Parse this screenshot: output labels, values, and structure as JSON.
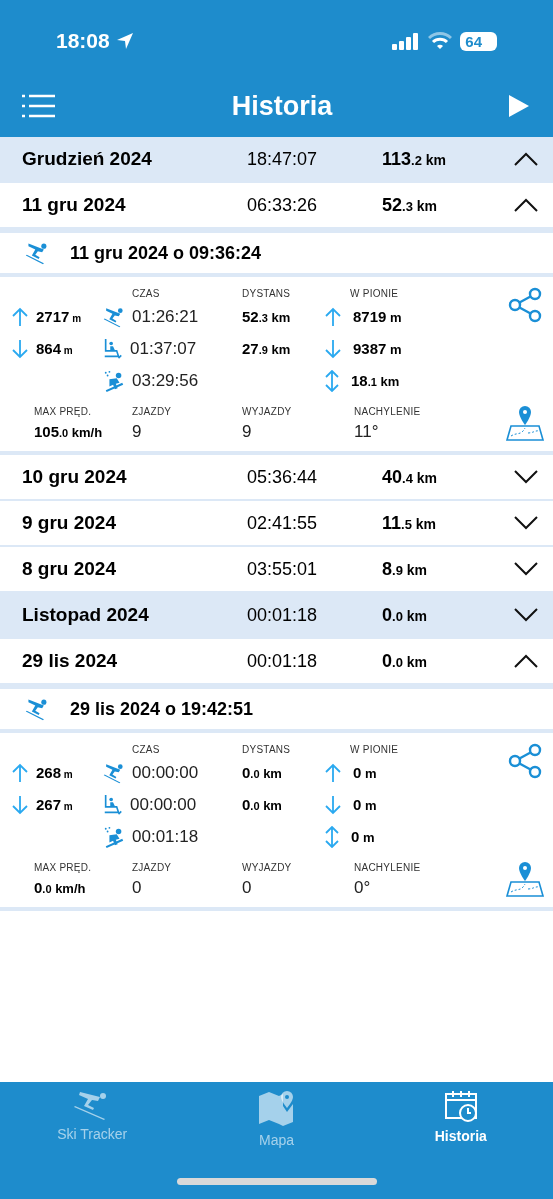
{
  "status_bar": {
    "time": "18:08",
    "battery": "64"
  },
  "header": {
    "title": "Historia"
  },
  "rows": [
    {
      "kind": "month",
      "label": "Grudzień 2024",
      "time": "18:47:07",
      "distance": {
        "int": "113",
        "dec": ".2",
        "unit": "km"
      },
      "expanded": true
    },
    {
      "kind": "day",
      "label": "11 gru 2024",
      "time": "06:33:26",
      "distance": {
        "int": "52",
        "dec": ".3",
        "unit": "km"
      },
      "expanded": true
    },
    {
      "kind": "session",
      "title": "11 gru 2024 o 09:36:24",
      "altitude": [
        {
          "kind": "up",
          "value": {
            "int": "2717",
            "unit": "m"
          }
        },
        {
          "kind": "down",
          "value": {
            "int": "864",
            "unit": "m"
          }
        }
      ],
      "headers": [
        "CZAS",
        "DYSTANS",
        "W PIONIE"
      ],
      "times": [
        {
          "kind": "ski",
          "value": "01:26:21"
        },
        {
          "kind": "lift",
          "value": "01:37:07"
        },
        {
          "kind": "other",
          "value": "03:29:56"
        }
      ],
      "distances": [
        {
          "int": "52",
          "dec": ".3",
          "unit": "km"
        },
        {
          "int": "27",
          "dec": ".9",
          "unit": "km"
        }
      ],
      "vertical": [
        {
          "kind": "up",
          "value": {
            "int": "8719",
            "unit": "m"
          }
        },
        {
          "kind": "down",
          "value": {
            "int": "9387",
            "unit": "m"
          }
        },
        {
          "kind": "both",
          "value": {
            "int": "18",
            "dec": ".1",
            "unit": "km"
          }
        }
      ],
      "summary_labels": [
        "MAX PRĘD.",
        "ZJAZDY",
        "WYJAZDY",
        "NACHYLENIE"
      ],
      "max_speed": {
        "int": "105",
        "dec": ".0",
        "unit": "km/h"
      },
      "summary_values": [
        "9",
        "9",
        "11°"
      ]
    },
    {
      "kind": "day",
      "label": "10 gru 2024",
      "time": "05:36:44",
      "distance": {
        "int": "40",
        "dec": ".4",
        "unit": "km"
      },
      "expanded": false
    },
    {
      "kind": "day",
      "label": "9 gru 2024",
      "time": "02:41:55",
      "distance": {
        "int": "11",
        "dec": ".5",
        "unit": "km"
      },
      "expanded": false
    },
    {
      "kind": "day",
      "label": "8 gru 2024",
      "time": "03:55:01",
      "distance": {
        "int": "8",
        "dec": ".9",
        "unit": "km"
      },
      "expanded": false
    },
    {
      "kind": "month",
      "label": "Listopad 2024",
      "time": "00:01:18",
      "distance": {
        "int": "0",
        "dec": ".0",
        "unit": "km"
      },
      "expanded": false
    },
    {
      "kind": "day",
      "label": "29 lis 2024",
      "time": "00:01:18",
      "distance": {
        "int": "0",
        "dec": ".0",
        "unit": "km"
      },
      "expanded": true
    },
    {
      "kind": "session",
      "title": "29 lis 2024 o 19:42:51",
      "altitude": [
        {
          "kind": "up",
          "value": {
            "int": "268",
            "unit": "m"
          }
        },
        {
          "kind": "down",
          "value": {
            "int": "267",
            "unit": "m"
          }
        }
      ],
      "headers": [
        "CZAS",
        "DYSTANS",
        "W PIONIE"
      ],
      "times": [
        {
          "kind": "ski",
          "value": "00:00:00"
        },
        {
          "kind": "lift",
          "value": "00:00:00"
        },
        {
          "kind": "other",
          "value": "00:01:18"
        }
      ],
      "distances": [
        {
          "int": "0",
          "dec": ".0",
          "unit": "km"
        },
        {
          "int": "0",
          "dec": ".0",
          "unit": "km"
        }
      ],
      "vertical": [
        {
          "kind": "up",
          "value": {
            "int": "0",
            "unit": "m"
          }
        },
        {
          "kind": "down",
          "value": {
            "int": "0",
            "unit": "m"
          }
        },
        {
          "kind": "both",
          "value": {
            "int": "0",
            "unit": "m"
          }
        }
      ],
      "summary_labels": [
        "MAX PRĘD.",
        "ZJAZDY",
        "WYJAZDY",
        "NACHYLENIE"
      ],
      "max_speed": {
        "int": "0",
        "dec": ".0",
        "unit": "km/h"
      },
      "summary_values": [
        "0",
        "0",
        "0°"
      ]
    }
  ],
  "tab_bar": [
    {
      "kind": "ski",
      "label": "Ski Tracker",
      "selected": false
    },
    {
      "kind": "map",
      "label": "Mapa",
      "selected": false
    },
    {
      "kind": "history",
      "label": "Historia",
      "selected": true
    }
  ]
}
